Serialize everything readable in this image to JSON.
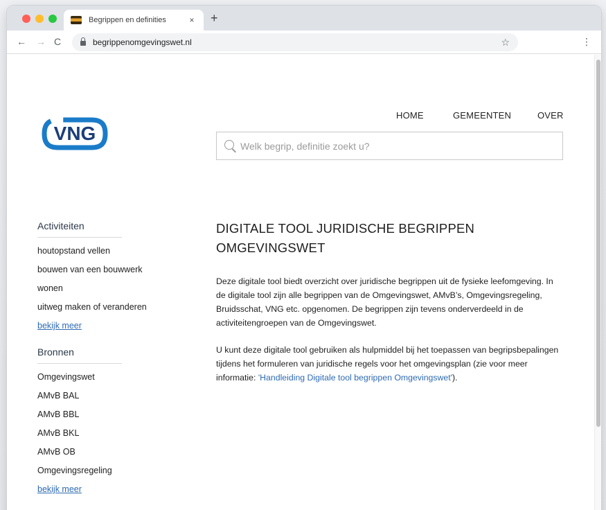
{
  "browser": {
    "tab_title": "Begrippen en definities",
    "tab_close": "×",
    "new_tab": "+",
    "back": "←",
    "forward": "→",
    "reload": "C",
    "url": "begrippenomgevingswet.nl",
    "bookmark": "☆",
    "menu": "⋮",
    "colors": {
      "tabstrip": "#dee1e6",
      "omnibox": "#f1f3f4"
    }
  },
  "site": {
    "logo_text": "VNG",
    "brand_color": "#1a7cc9",
    "nav": [
      "HOME",
      "GEMEENTEN",
      "OVER"
    ],
    "search_placeholder": "Welk begrip, definitie zoekt u?"
  },
  "sidebar": {
    "activiteiten": {
      "heading": "Activiteiten",
      "items": [
        "houtopstand vellen",
        "bouwen van een bouwwerk",
        "wonen",
        "uitweg maken of veranderen"
      ],
      "more": "bekijk meer"
    },
    "bronnen": {
      "heading": "Bronnen",
      "items": [
        "Omgevingswet",
        "AMvB BAL",
        "AMvB BBL",
        "AMvB BKL",
        "AMvB OB",
        "Omgevingsregeling"
      ],
      "more": "bekijk meer"
    }
  },
  "main": {
    "title": "DIGITALE TOOL JURIDISCHE BEGRIPPEN OMGEVINGSWET",
    "paragraph1": "Deze digitale tool biedt overzicht over juridische begrippen uit de fysieke leefomgeving. In de digitale tool zijn alle begrippen van de Omgevingswet, AMvB’s, Omgevingsregeling, Bruidsschat, VNG etc. opgenomen. De begrippen zijn tevens onderverdeeld in de activiteitengroepen van de Omgevingswet.",
    "paragraph2_prefix": "U kunt deze digitale tool gebruiken als hulpmiddel bij het toepassen van begripsbepalingen tijdens het formuleren van juridische regels voor het omgevingsplan (zie voor meer informatie: ",
    "paragraph2_link": "'Handleiding Digitale tool begrippen Omgevingswet'",
    "paragraph2_suffix": ").",
    "link_color": "#2d6ab2"
  }
}
